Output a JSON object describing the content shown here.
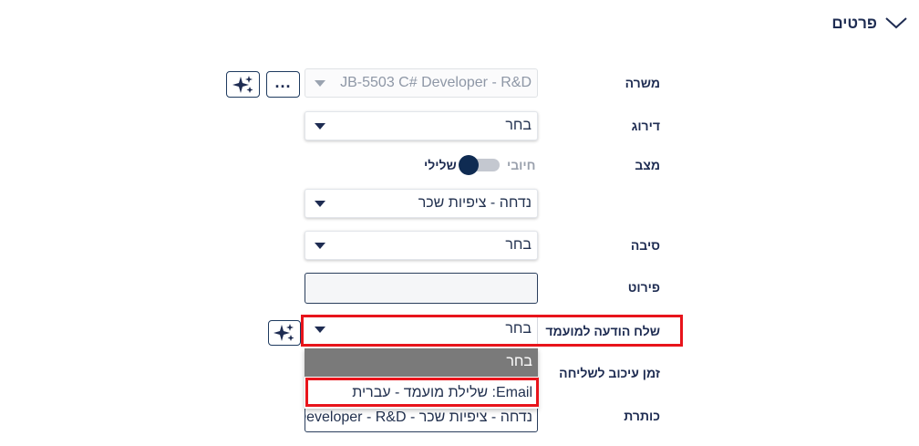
{
  "section": {
    "title": "פרטים"
  },
  "fields": {
    "position": {
      "label": "משרה",
      "value": "JB-5503 C# Developer - R&D"
    },
    "rating": {
      "label": "דירוג",
      "value": "בחר"
    },
    "status": {
      "label": "מצב",
      "positive": "חיובי",
      "negative": "שלילי",
      "state": "negative"
    },
    "status_reason_select": {
      "value": "נדחה - ציפיות שכר"
    },
    "reason": {
      "label": "סיבה",
      "value": "בחר"
    },
    "details": {
      "label": "פירוט",
      "value": ""
    },
    "notify": {
      "label": "שלח הודעה למועמד",
      "value": "בחר"
    },
    "delay": {
      "label": "זמן עיכוב לשליחה"
    },
    "subject": {
      "label": "כותרת",
      "value": "נדחה - ציפיות שכר - Developer - R&D"
    }
  },
  "notify_dropdown": {
    "options": [
      "בחר",
      "Email: שלילת מועמד - עברית"
    ],
    "highlighted_index": 0
  },
  "icons": {
    "sparkle": "sparkle-icon",
    "more": "more-icon",
    "chevron": "chevron-down-icon"
  },
  "colors": {
    "accent": "#1e2c52",
    "highlight": "#e8141b",
    "option_selected_bg": "#7a7a7a"
  }
}
